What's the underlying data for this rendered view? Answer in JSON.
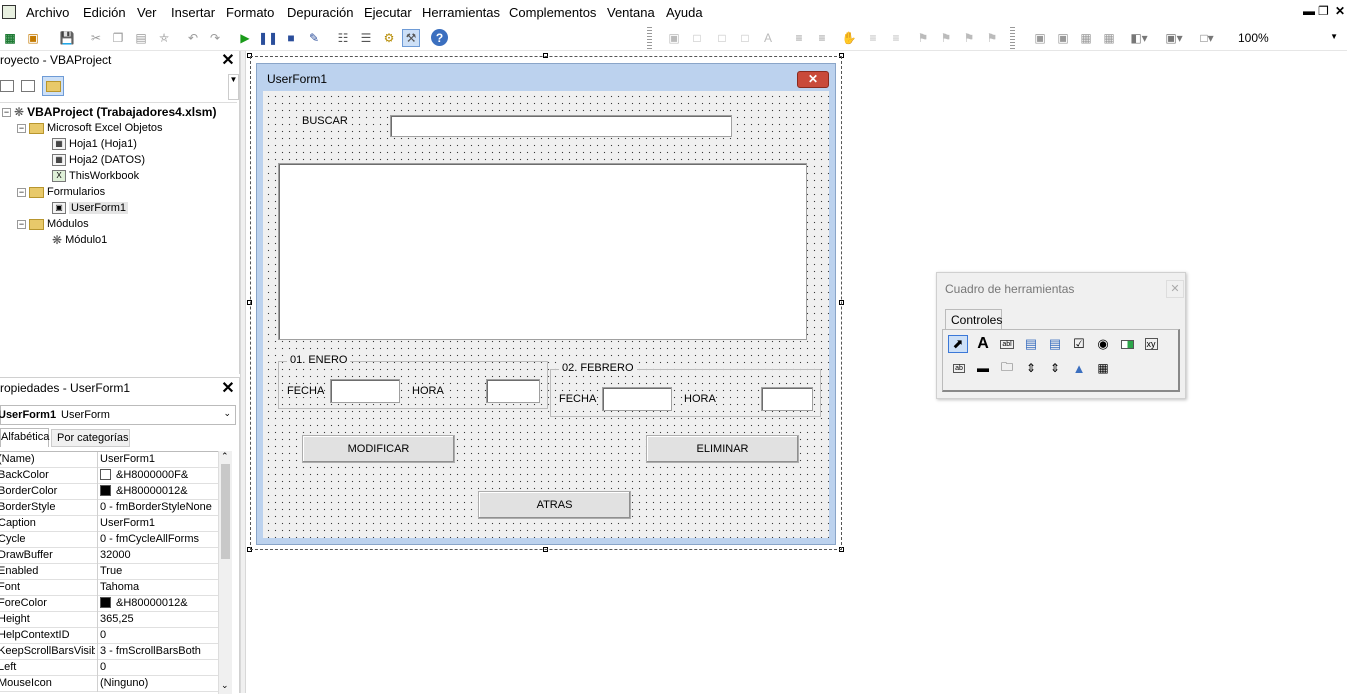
{
  "menu": {
    "items": [
      "Archivo",
      "Edición",
      "Ver",
      "Insertar",
      "Formato",
      "Depuración",
      "Ejecutar",
      "Herramientas",
      "Complementos",
      "Ventana",
      "Ayuda"
    ]
  },
  "toolbar": {
    "zoom": "100%"
  },
  "project": {
    "title": "royecto - VBAProject",
    "tree": {
      "root": "VBAProject (Trabajadores4.xlsm)",
      "excel_objects": "Microsoft Excel Objetos",
      "sheet1": "Hoja1 (Hoja1)",
      "sheet2": "Hoja2 (DATOS)",
      "workbook": "ThisWorkbook",
      "forms": "Formularios",
      "userform": "UserForm1",
      "modules": "Módulos",
      "module1": "Módulo1"
    }
  },
  "properties": {
    "title": "ropiedades - UserForm1",
    "object_name": "UserForm1",
    "object_type": "UserForm",
    "tab_alpha": "Alfabética",
    "tab_category": "Por categorías",
    "rows": [
      {
        "name": "(Name)",
        "value": "UserForm1",
        "swatch": null
      },
      {
        "name": "BackColor",
        "value": "&H8000000F&",
        "swatch": "#ffffff"
      },
      {
        "name": "BorderColor",
        "value": "&H80000012&",
        "swatch": "#000000"
      },
      {
        "name": "BorderStyle",
        "value": "0 - fmBorderStyleNone",
        "swatch": null
      },
      {
        "name": "Caption",
        "value": "UserForm1",
        "swatch": null
      },
      {
        "name": "Cycle",
        "value": "0 - fmCycleAllForms",
        "swatch": null
      },
      {
        "name": "DrawBuffer",
        "value": "32000",
        "swatch": null
      },
      {
        "name": "Enabled",
        "value": "True",
        "swatch": null
      },
      {
        "name": "Font",
        "value": "Tahoma",
        "swatch": null
      },
      {
        "name": "ForeColor",
        "value": "&H80000012&",
        "swatch": "#000000"
      },
      {
        "name": "Height",
        "value": "365,25",
        "swatch": null
      },
      {
        "name": "HelpContextID",
        "value": "0",
        "swatch": null
      },
      {
        "name": "KeepScrollBarsVisible",
        "value": "3 - fmScrollBarsBoth",
        "swatch": null
      },
      {
        "name": "Left",
        "value": "0",
        "swatch": null
      },
      {
        "name": "MouseIcon",
        "value": "(Ninguno)",
        "swatch": null
      }
    ]
  },
  "userform": {
    "title": "UserForm1",
    "buscar_label": "BUSCAR",
    "frame_enero": "01. ENERO",
    "frame_febrero": "02. FEBRERO",
    "fecha_label": "FECHA",
    "hora_label": "HORA",
    "modificar": "MODIFICAR",
    "eliminar": "ELIMINAR",
    "atras": "ATRAS"
  },
  "toolbox": {
    "title": "Cuadro de herramientas",
    "tab": "Controles"
  }
}
